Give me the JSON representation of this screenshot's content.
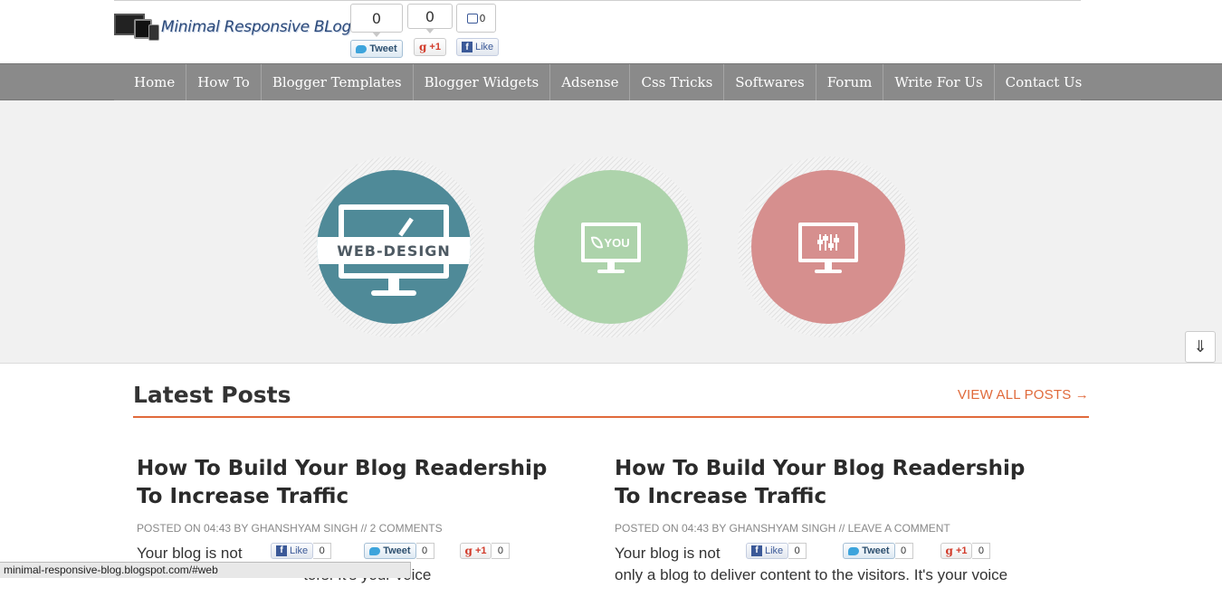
{
  "header": {
    "logo_text": "Minimal Responsive BLog",
    "share": {
      "tweet_count": "0",
      "tweet_label": "Tweet",
      "gplus_count": "0",
      "gplus_label": "+1",
      "like_count": "0",
      "like_label": "Like"
    }
  },
  "nav": {
    "items": [
      {
        "label": "Home"
      },
      {
        "label": "How To"
      },
      {
        "label": "Blogger Templates"
      },
      {
        "label": "Blogger Widgets"
      },
      {
        "label": "Adsense"
      },
      {
        "label": "Css Tricks"
      },
      {
        "label": "Softwares"
      },
      {
        "label": "Forum"
      },
      {
        "label": "Write For Us"
      },
      {
        "label": "Contact Us"
      }
    ]
  },
  "hero": {
    "circles": [
      {
        "label": "WEB-DESIGN",
        "color": "#4f8a98",
        "icon": "monitor-pencil-icon"
      },
      {
        "label": "YOU",
        "color": "#add3ab",
        "icon": "monitor-leaf-icon"
      },
      {
        "label": "",
        "color": "#d68f8e",
        "icon": "monitor-equalizer-icon"
      }
    ],
    "scroll_icon": "⇓"
  },
  "latest": {
    "title": "Latest Posts",
    "view_all": "VIEW ALL POSTS →"
  },
  "posts": [
    {
      "title": "How To Build Your Blog Readership To Increase Traffic",
      "meta": "POSTED ON 04:43 BY GHANSHYAM SINGH // 2 COMMENTS",
      "body_line1": "Your blog is not",
      "body_line2": "                                       tors. It's your voice",
      "like_label": "Like",
      "like_count": "0",
      "tweet_label": "Tweet",
      "tweet_count": "0",
      "gplus_label": "+1",
      "gplus_count": "0"
    },
    {
      "title": "How To Build Your Blog Readership To Increase Traffic",
      "meta": "POSTED ON 04:43 BY GHANSHYAM SINGH // LEAVE A COMMENT",
      "body_line1": "Your blog is not",
      "body_line2": "only a blog to deliver content to the visitors. It's your voice",
      "like_label": "Like",
      "like_count": "0",
      "tweet_label": "Tweet",
      "tweet_count": "0",
      "gplus_label": "+1",
      "gplus_count": "0"
    }
  ],
  "statusbar": {
    "url": "minimal-responsive-blog.blogspot.com/#web"
  },
  "colors": {
    "nav_bg": "#8a8a8a",
    "accent": "#e06a3b",
    "hero_bg": "#f1f1f1"
  }
}
